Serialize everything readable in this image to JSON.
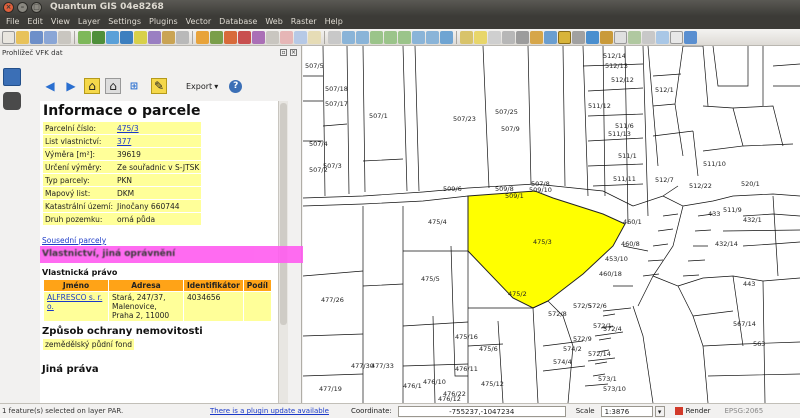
{
  "window": {
    "title": "Quantum GIS 04e8268"
  },
  "menu": [
    "File",
    "Edit",
    "View",
    "Layer",
    "Settings",
    "Plugins",
    "Vector",
    "Database",
    "Web",
    "Raster",
    "Help"
  ],
  "panel": {
    "title": "Prohlížeč VFK dat",
    "export_label": "Export",
    "heading": "Informace o parcele",
    "info_rows": [
      {
        "key": "Parcelní číslo:",
        "value": "475/3",
        "link": true
      },
      {
        "key": "List vlastnictví:",
        "value": "377",
        "link": true
      },
      {
        "key": "Výměra [m²]:",
        "value": "39619",
        "link": false
      },
      {
        "key": "Určení výměry:",
        "value": "Ze souřadnic v S-JTSK",
        "link": false
      },
      {
        "key": "Typ parcely:",
        "value": "PKN",
        "link": false
      },
      {
        "key": "Mapový list:",
        "value": "DKM",
        "link": false
      },
      {
        "key": "Katastrální území:",
        "value": "Jinočany 660744",
        "link": false
      },
      {
        "key": "Druh pozemku:",
        "value": "orná půda",
        "link": false
      }
    ],
    "neighbors_link": "Sousední parcely",
    "ownership_heading": "Vlastnická právo",
    "highlight_text": "Vlastnictví, jiná oprávnění",
    "owners_headers": [
      "Jméno",
      "Adresa",
      "Identifikátor",
      "Podíl"
    ],
    "owners_rows": [
      {
        "name": "ALFRESCO s. r. o.",
        "address": "Stará, 247/37, Malenovice, Praha 2, 11000",
        "id": "4034656",
        "share": ""
      }
    ],
    "protection_heading": "Způsob ochrany nemovitosti",
    "protection_value": "zemědělský půdní fond",
    "other_rights_heading": "Jiná práva"
  },
  "map": {
    "highlight_color": "#ffff00",
    "selected_parcel": "475/3",
    "labels": [
      "507/5",
      "507/18",
      "507/17",
      "507/23",
      "507/9",
      "507/25",
      "507/1",
      "507/4",
      "507/2",
      "507/3",
      "507/8",
      "509/6",
      "509/8",
      "509/1",
      "509/10",
      "475/4",
      "475/5",
      "475/6",
      "475/2",
      "475/3",
      "477/26",
      "477/30",
      "477/33",
      "477/19",
      "476/1",
      "476/10",
      "475/16",
      "475/12",
      "476/11",
      "476/12",
      "476/22",
      "512/13",
      "512/14",
      "512/12",
      "511/12",
      "512/1",
      "511/13",
      "511/6",
      "511/1",
      "511/11",
      "512/7",
      "512/22",
      "511/10",
      "520/1",
      "511/9",
      "433",
      "432/14",
      "432/1",
      "460/1",
      "460/8",
      "460/18",
      "453/10",
      "572/5",
      "572/8",
      "572/6",
      "572/4",
      "572/1",
      "572/9",
      "572/14",
      "574/2",
      "574/4",
      "573/1",
      "573/10",
      "567/14",
      "563",
      "443"
    ]
  },
  "status": {
    "message": "1 feature(s) selected on layer PAR.",
    "plugin_update": "There is a plugin update available",
    "coordinate_label": "Coordinate:",
    "coordinate_value": "-755237,-1047234",
    "scale_label": "Scale",
    "scale_value": "1:3876",
    "render_label": "Render",
    "epsg": "EPSG:2065"
  }
}
